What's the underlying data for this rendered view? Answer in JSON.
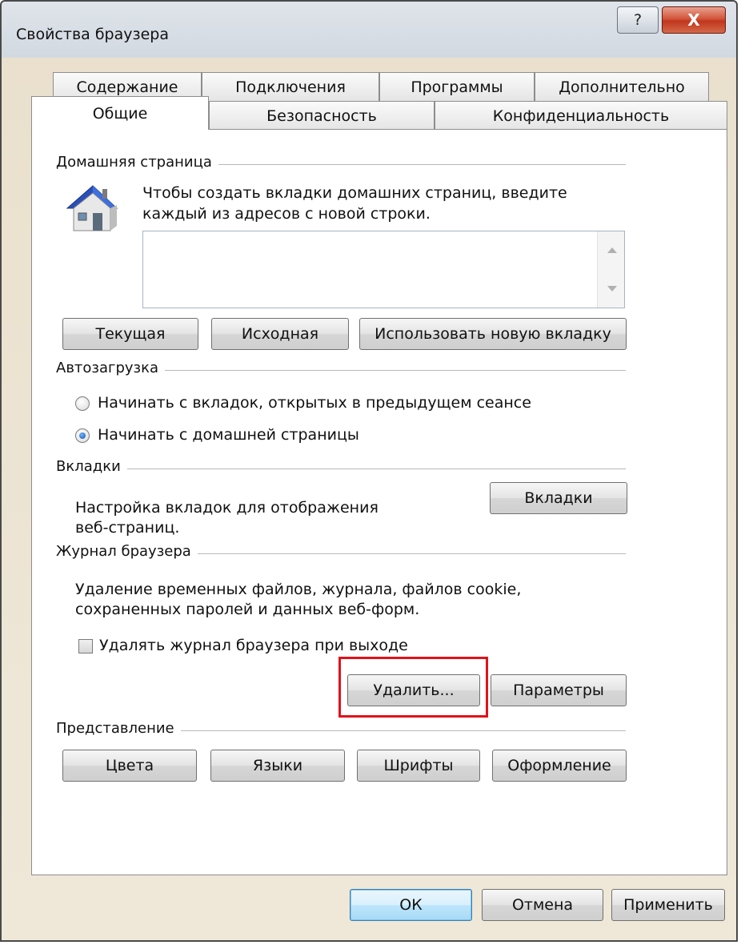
{
  "window": {
    "title": "Свойства браузера",
    "help_glyph": "?",
    "close_glyph": "X"
  },
  "tabs": {
    "row_top": [
      "Содержание",
      "Подключения",
      "Программы",
      "Дополнительно"
    ],
    "row_bottom": [
      "Общие",
      "Безопасность",
      "Конфиденциальность"
    ],
    "active": "Общие"
  },
  "home": {
    "label": "Домашняя страница",
    "hint_line1": "Чтобы создать вкладки домашних страниц, введите",
    "hint_line2": "каждый из адресов с новой строки.",
    "textarea_value": "",
    "btn_current": "Текущая",
    "btn_default": "Исходная",
    "btn_new_tab": "Использовать новую вкладку"
  },
  "startup": {
    "label": "Автозагрузка",
    "option_prev": "Начинать с вкладок, открытых в предыдущем сеансе",
    "option_home": "Начинать с домашней страницы",
    "selected": "home"
  },
  "tabs_section": {
    "label": "Вкладки",
    "desc_line1": "Настройка вкладок для отображения",
    "desc_line2": "веб-страниц.",
    "btn": "Вкладки"
  },
  "history": {
    "label": "Журнал браузера",
    "desc_line1": "Удаление временных файлов, журнала, файлов cookie,",
    "desc_line2": "сохраненных паролей и данных веб-форм.",
    "checkbox_label": "Удалять журнал браузера при выходе",
    "checkbox_checked": false,
    "btn_delete": "Удалить...",
    "btn_settings": "Параметры",
    "highlight_color": "#e0121b"
  },
  "appearance": {
    "label": "Представление",
    "btn_colors": "Цвета",
    "btn_languages": "Языки",
    "btn_fonts": "Шрифты",
    "btn_accessibility": "Оформление"
  },
  "footer": {
    "ok": "ОК",
    "cancel": "Отмена",
    "apply": "Применить"
  }
}
